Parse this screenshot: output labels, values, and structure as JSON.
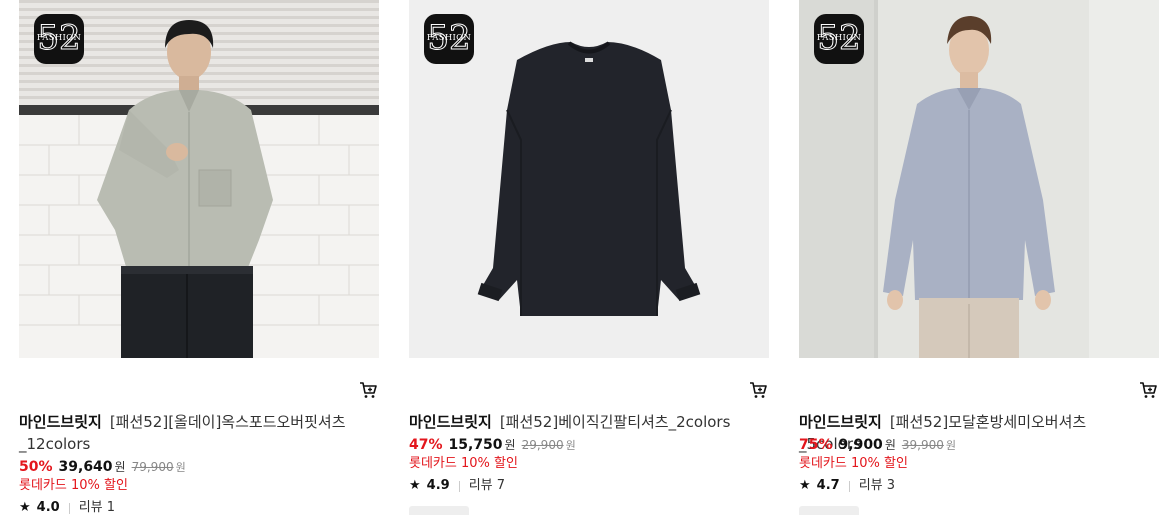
{
  "products": [
    {
      "badge_number": "52",
      "badge_word": "FASHION",
      "brand": "마인드브릿지",
      "name": "[패션52][올데이]옥스포드오버핏셔츠_12colors",
      "discount_rate": "50%",
      "price": "39,640",
      "currency": "원",
      "original_price": "79,900",
      "original_currency": "원",
      "card_promo": "롯데카드 10% 할인",
      "rating": "4.0",
      "review_label": "리뷰",
      "review_count": "1",
      "cart_icon": "cart-icon"
    },
    {
      "badge_number": "52",
      "badge_word": "FASHION",
      "brand": "마인드브릿지",
      "name": "[패션52]베이직긴팔티셔츠_2colors",
      "discount_rate": "47%",
      "price": "15,750",
      "currency": "원",
      "original_price": "29,900",
      "original_currency": "원",
      "card_promo": "롯데카드 10% 할인",
      "rating": "4.9",
      "review_label": "리뷰",
      "review_count": "7",
      "cart_icon": "cart-icon"
    },
    {
      "badge_number": "52",
      "badge_word": "FASHION",
      "brand": "마인드브릿지",
      "name": "[패션52]모달혼방세미오버셔츠_5colors",
      "discount_rate": "75%",
      "price": "9,900",
      "currency": "원",
      "original_price": "39,900",
      "original_currency": "원",
      "card_promo": "롯데카드 10% 할인",
      "rating": "4.7",
      "review_label": "리뷰",
      "review_count": "3",
      "cart_icon": "cart-icon"
    }
  ],
  "colors": {
    "discount_red": "#e3161c",
    "badge_black": "#111111"
  }
}
